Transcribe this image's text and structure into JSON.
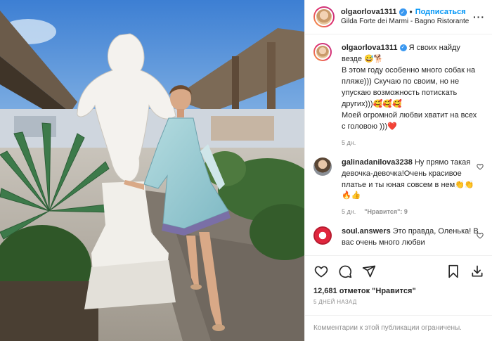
{
  "post": {
    "photo_alt": "",
    "header": {
      "username": "olgaorlova1311",
      "verified_symbol": "✓",
      "separator": "•",
      "follow_label": "Подписаться",
      "location": "Gilda Forte dei Marmi - Bagno Ristorante",
      "more_symbol": "···"
    },
    "caption": {
      "username": "olgaorlova1311",
      "lines": [
        "Я своих найду везде 😅🐕",
        "В этом году особенно много собак на пляже))) Скучаю по своим, но не упускаю возможность потискать других)))🥰🥰🥰",
        "Моей огромной любви хватит на всех с головою )))❤️"
      ],
      "time": "5 дн."
    },
    "comments": [
      {
        "username": "galinadanilova3238",
        "text": "Ну прямо такая девочка-девочка!Очень красивое платье и ты юная совсем в нем👏👏🔥👍",
        "time": "5 дн.",
        "likes": "\"Нравится\": 9",
        "reply": ""
      },
      {
        "username": "soul.answers",
        "text": "Это правда, Оленька! В вас очень много любви",
        "time": "",
        "likes": "",
        "reply": ""
      }
    ],
    "likes_text": "12,681 отметок \"Нравится\"",
    "date_text": "5 ДНЕЙ НАЗАД",
    "comments_closed": "Комментарии к этой публикации ограничены."
  },
  "colors": {
    "accent": "#0095f6",
    "verified": "#3897f0",
    "muted": "#8e8e8e",
    "heart_red": "#ed4956"
  }
}
